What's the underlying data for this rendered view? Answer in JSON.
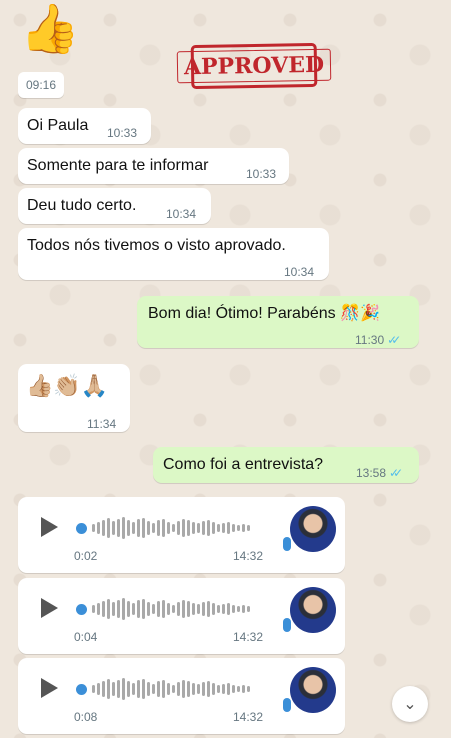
{
  "stamp": {
    "text": "APPROVED"
  },
  "messages": {
    "sticker": {
      "emoji": "👍",
      "time": "09:16"
    },
    "m1": {
      "text": "Oi Paula",
      "time": "10:33"
    },
    "m2": {
      "text": "Somente para te informar",
      "time": "10:33"
    },
    "m3": {
      "text": "Deu tudo certo.",
      "time": "10:34"
    },
    "m4": {
      "text": "Todos nós tivemos o visto aprovado.",
      "time": "10:34"
    },
    "m5": {
      "text": "Bom dia! Ótimo! Parabéns 🎊🎉",
      "time": "11:30",
      "ticks": "✓✓"
    },
    "m6": {
      "text": "👍🏼👏🏼🙏🏼",
      "time": "11:34"
    },
    "m7": {
      "text": "Como foi a entrevista?",
      "time": "13:58",
      "ticks": "✓✓"
    }
  },
  "audios": [
    {
      "duration": "0:02",
      "time": "14:32"
    },
    {
      "duration": "0:04",
      "time": "14:32"
    },
    {
      "duration": "0:08",
      "time": "14:32"
    }
  ],
  "scroll_button": {
    "icon": "chevron-down-icon",
    "glyph": "⌄"
  }
}
